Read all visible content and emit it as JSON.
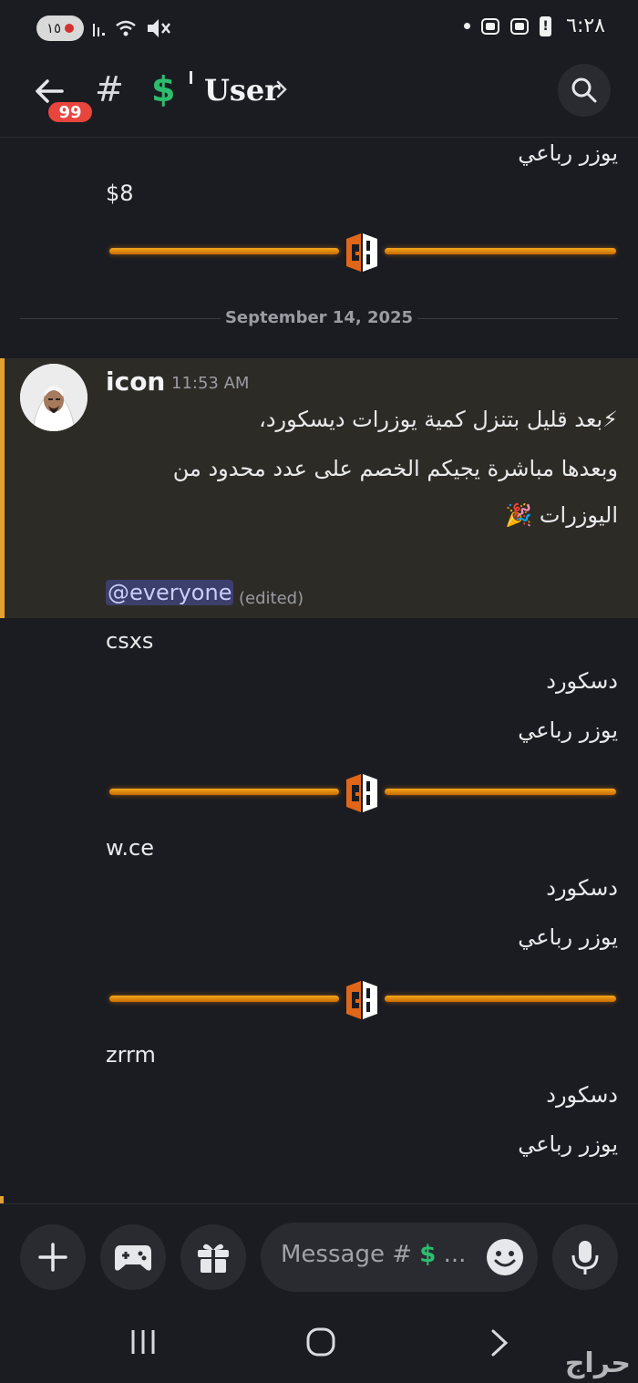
{
  "status_bar": {
    "pill_text": "١٥",
    "time": "٦:٢٨"
  },
  "header": {
    "badge_count": "99",
    "channel_hash": "#",
    "channel_symbol": "$",
    "title": "User"
  },
  "messages": {
    "top_rtl": "يوزر رباعي",
    "top_price": "$8",
    "date_divider": "September 14, 2025",
    "post": {
      "author": "icon",
      "time": "11:53 AM",
      "line1": "⚡بعد قليل بتنزل كمية يوزرات ديسكورد،",
      "line2": "وبعدها مباشرة يجيكم الخصم  على عدد محدود من",
      "line3": "اليوزرات 🎉",
      "mention": "@everyone",
      "edited": "(edited)"
    },
    "listings": [
      {
        "name": "csxs",
        "platform": "دسكورد",
        "type": "يوزر رباعي"
      },
      {
        "name": "w.ce",
        "platform": "دسكورد",
        "type": "يوزر رباعي"
      },
      {
        "name": "zrrm",
        "platform": "دسكورد",
        "type": "يوزر رباعي"
      }
    ]
  },
  "composer": {
    "placeholder_prefix": "Message #",
    "placeholder_symbol": "$",
    "placeholder_suffix": " ..."
  },
  "watermark": "حراج",
  "colors": {
    "background": "#1b1c21",
    "accent_orange": "#f4a71e",
    "green": "#2dbd6e",
    "badge_red": "#e8453c",
    "highlight_bg": "#2d2b26",
    "highlight_bar": "#e3a230"
  }
}
